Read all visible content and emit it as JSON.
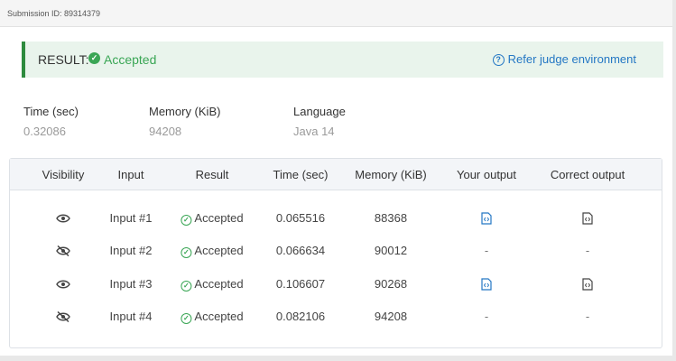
{
  "header": {
    "submission_id": "Submission ID: 89314379"
  },
  "result": {
    "label": "RESULT:",
    "status": "Accepted",
    "judge_link": "Refer judge environment",
    "check_icon": "check-circle-icon",
    "link_icon": "question-circle-icon"
  },
  "stats": [
    {
      "label": "Time (sec)",
      "value": "0.32086"
    },
    {
      "label": "Memory (KiB)",
      "value": "94208"
    },
    {
      "label": "Language",
      "value": "Java 14"
    }
  ],
  "table": {
    "headers": [
      "Visibility",
      "Input",
      "Result",
      "Time (sec)",
      "Memory (KiB)",
      "Your output",
      "Correct output"
    ],
    "rows": [
      {
        "visibility": "visible",
        "input": "Input #1",
        "result": "Accepted",
        "time": "0.065516",
        "memory": "88368",
        "your_output": "file",
        "correct_output": "file"
      },
      {
        "visibility": "hidden",
        "input": "Input #2",
        "result": "Accepted",
        "time": "0.066634",
        "memory": "90012",
        "your_output": "-",
        "correct_output": "-"
      },
      {
        "visibility": "visible",
        "input": "Input #3",
        "result": "Accepted",
        "time": "0.106607",
        "memory": "90268",
        "your_output": "file",
        "correct_output": "file"
      },
      {
        "visibility": "hidden",
        "input": "Input #4",
        "result": "Accepted",
        "time": "0.082106",
        "memory": "94208",
        "your_output": "-",
        "correct_output": "-"
      }
    ]
  },
  "colors": {
    "accent_green": "#3aa655",
    "link_blue": "#2477c4",
    "result_bg": "#e9f4ec",
    "result_border": "#2e8b3e"
  }
}
